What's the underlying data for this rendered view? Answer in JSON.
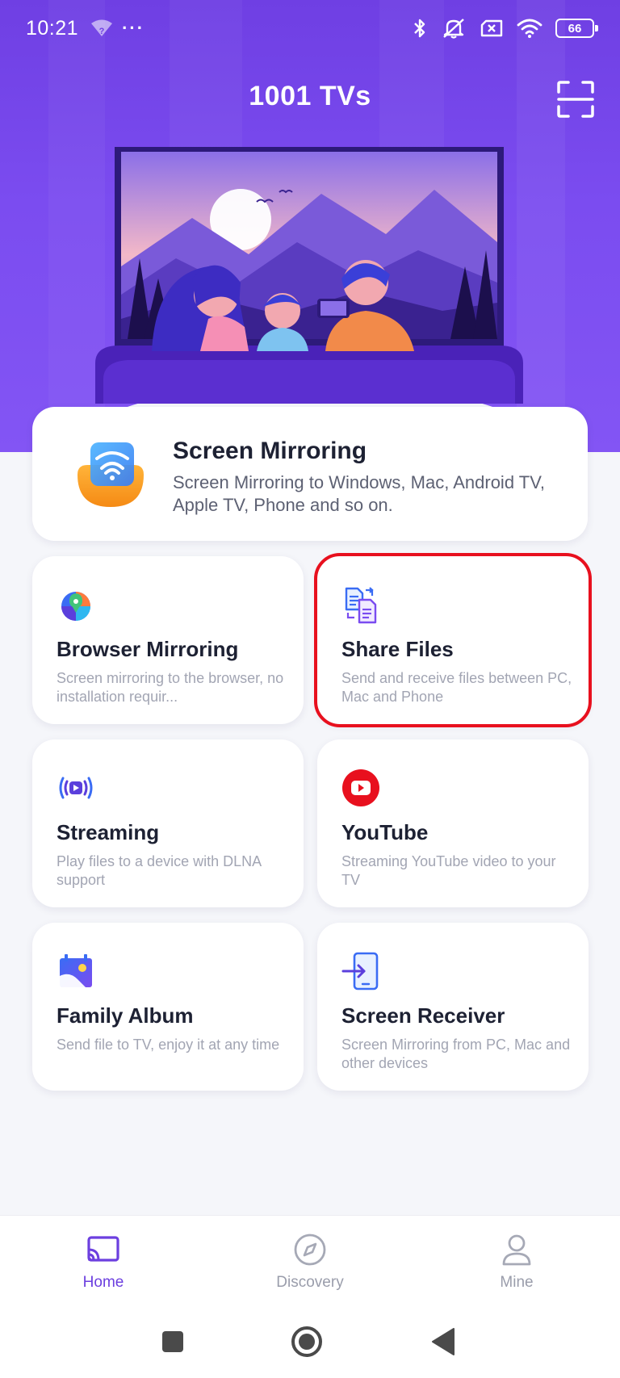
{
  "status_bar": {
    "time": "10:21",
    "dots": "···",
    "battery": "66",
    "icons": [
      "wifi-question-icon",
      "bluetooth-icon",
      "mute-icon",
      "sim-x-icon",
      "wifi-icon",
      "battery-icon"
    ]
  },
  "header": {
    "title": "1001 TVs",
    "scan_icon": "scan-icon"
  },
  "main_card": {
    "title": "Screen Mirroring",
    "description": "Screen Mirroring to Windows, Mac, Android TV, Apple TV, Phone and so on.",
    "icon": "screen-mirroring-icon"
  },
  "features": [
    {
      "title": "Browser Mirroring",
      "description": "Screen mirroring to the browser, no installation requir...",
      "icon": "browser-icon"
    },
    {
      "title": "Share Files",
      "description": "Send and receive files between PC, Mac and Phone",
      "icon": "share-files-icon",
      "highlighted": true
    },
    {
      "title": "Streaming",
      "description": "Play files to a device with DLNA support",
      "icon": "streaming-icon"
    },
    {
      "title": "YouTube",
      "description": "Streaming YouTube video to your TV",
      "icon": "youtube-icon"
    },
    {
      "title": "Family Album",
      "description": "Send file to TV, enjoy it at any time",
      "icon": "family-album-icon"
    },
    {
      "title": "Screen Receiver",
      "description": "Screen Mirroring from PC, Mac and other devices",
      "icon": "screen-receiver-icon"
    }
  ],
  "bottom_nav": [
    {
      "label": "Home",
      "icon": "cast-icon",
      "active": true
    },
    {
      "label": "Discovery",
      "icon": "compass-icon",
      "active": false
    },
    {
      "label": "Mine",
      "icon": "person-icon",
      "active": false
    }
  ],
  "system_nav": [
    "recents-square-icon",
    "home-circle-icon",
    "back-triangle-icon"
  ],
  "colors": {
    "primary": "#6c3fdf",
    "header_gradient_top": "#6f3fe3",
    "highlight_border": "#e8101e",
    "youtube_red": "#e8101e",
    "background": "#f5f6fa"
  }
}
